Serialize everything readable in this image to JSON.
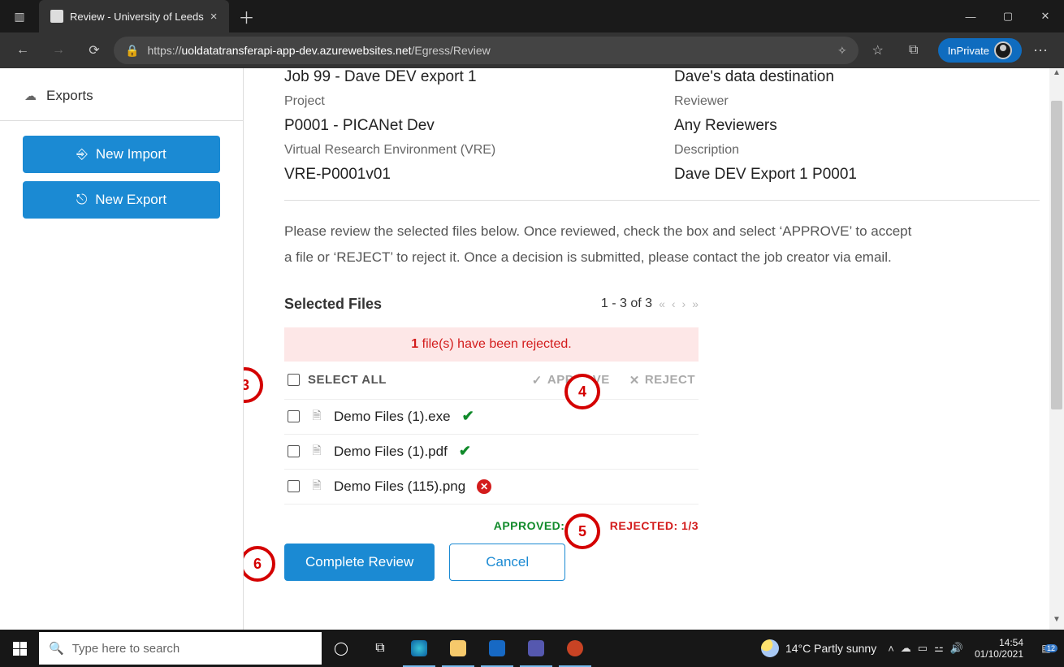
{
  "browser": {
    "tab_title": "Review - University of Leeds",
    "url_host": "uoldatatransferapi-app-dev.azurewebsites.net",
    "url_path": "/Egress/Review",
    "url_scheme": "https://",
    "inprivate": "InPrivate"
  },
  "sidebar": {
    "items": [
      {
        "icon": "cloud-up",
        "label": "Exports"
      }
    ],
    "new_import": "New Import",
    "new_export": "New Export"
  },
  "details": {
    "left": [
      {
        "label": "",
        "value": "Job 99 - Dave DEV export 1"
      },
      {
        "label": "Project",
        "value": "P0001 - PICANet Dev"
      },
      {
        "label": "Virtual Research Environment (VRE)",
        "value": "VRE-P0001v01"
      }
    ],
    "right": [
      {
        "label": "",
        "value": "Dave's data destination"
      },
      {
        "label": "Reviewer",
        "value": "Any Reviewers"
      },
      {
        "label": "Description",
        "value": "Dave DEV Export 1 P0001"
      }
    ]
  },
  "instructions": "Please review the selected files below. Once reviewed, check the box and select ‘APPROVE’ to accept a file or ‘REJECT’ to reject it. Once a decision is submitted, please contact the job creator via email.",
  "files_section": {
    "title": "Selected Files",
    "range": "1 - 3 of 3",
    "alert_count": "1",
    "alert_text": " file(s) have been rejected.",
    "select_all": "SELECT ALL",
    "approve": "APPROVE",
    "reject": "REJECT",
    "rows": [
      {
        "name": "Demo Files (1).exe",
        "status": "ok"
      },
      {
        "name": "Demo Files (1).pdf",
        "status": "ok"
      },
      {
        "name": "Demo Files (115).png",
        "status": "bad"
      }
    ],
    "summary_approved": "APPROVED: 2/3",
    "summary_rejected": "REJECTED: 1/3",
    "complete": "Complete Review",
    "cancel": "Cancel"
  },
  "annotations": {
    "a3": "3",
    "a4": "4",
    "a5": "5",
    "a6": "6"
  },
  "taskbar": {
    "search_placeholder": "Type here to search",
    "weather": "14°C  Partly sunny",
    "time": "14:54",
    "date": "01/10/2021",
    "notif": "12"
  }
}
